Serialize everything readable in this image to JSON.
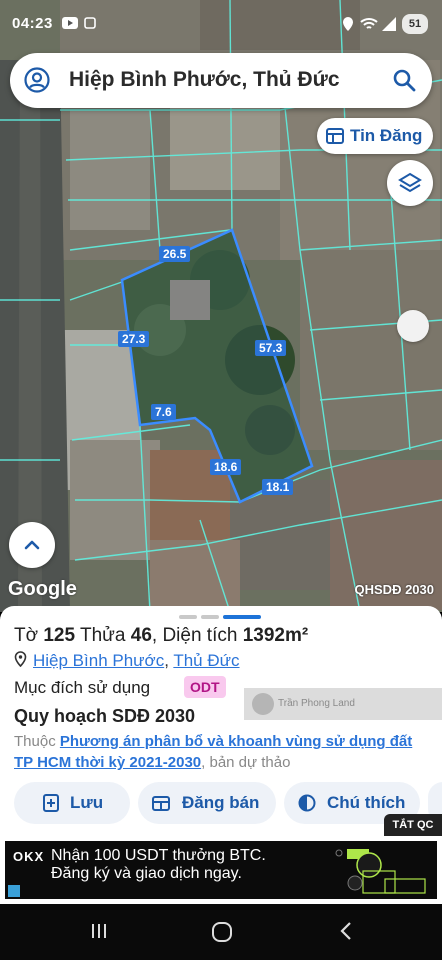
{
  "status": {
    "time": "04:23",
    "battery": "51"
  },
  "search": {
    "query": "Hiệp Bình Phước, Thủ Đức"
  },
  "chip": {
    "label": "Tin Đăng"
  },
  "map": {
    "dimensions": [
      "26.5",
      "57.3",
      "27.3",
      "7.6",
      "18.6",
      "18.1"
    ],
    "google": "Google",
    "layer_code": "QHSDĐ 2030"
  },
  "parcel": {
    "to_label": "Tờ",
    "to_value": "125",
    "thua_label": "Thửa",
    "thua_value": "46",
    "area_label": ", Diện tích",
    "area_value": "1392m²",
    "ward": "Hiệp Bình Phước",
    "district": "Thủ Đức",
    "purpose_label": "Mục đích sử dụng",
    "purpose_value": "ODT",
    "plan_title": "Quy hoạch SDĐ 2030",
    "desc_prefix": "Thuộc",
    "desc_link": "Phương án phân bổ và khoanh vùng sử dụng đất TP HCM thời kỳ 2021-2030",
    "desc_suffix": ", bản dự thảo"
  },
  "watermark": "Trần Phong Land",
  "actions": {
    "save": "Lưu",
    "sell": "Đăng bán",
    "legend": "Chú thích"
  },
  "ad": {
    "close_label": "TẮT QC",
    "logo": "OKX",
    "line1": "Nhận 100 USDT thưởng BTC.",
    "line2": "Đăng ký và giao dịch ngay."
  },
  "colors": {
    "accent": "#1d5aa8",
    "link": "#2b74d8",
    "parcel_outline": "#3b8cff",
    "badge_bg": "#f9c9ee"
  }
}
